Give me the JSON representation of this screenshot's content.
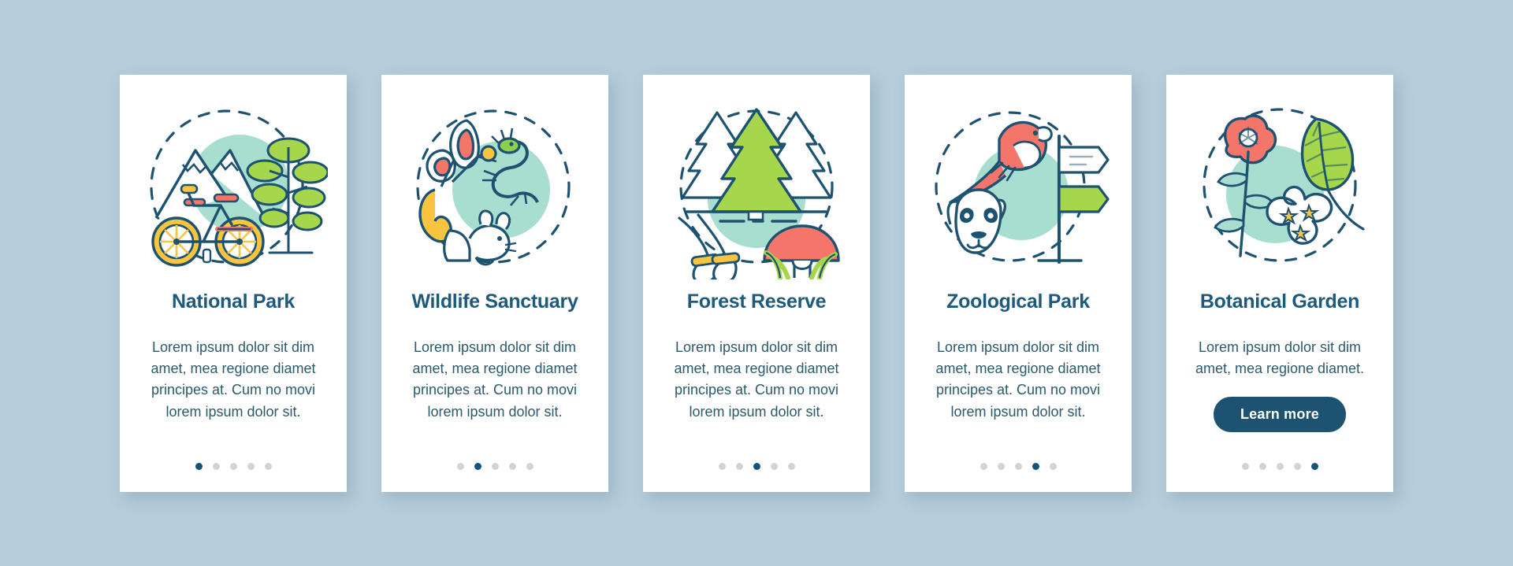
{
  "background_color": "#b5cdda",
  "theme": {
    "title_color": "#1e5a7d",
    "body_color": "#2b5b6b",
    "accent_dark": "#1d5271",
    "dot_active": "#14547c",
    "dot_inactive": "#cfd4d7",
    "illustration_green": "#a5d64c",
    "illustration_mint": "#a8ded0",
    "illustration_coral": "#f4766a",
    "illustration_yellow": "#f9c440",
    "illustration_outline": "#1d5271"
  },
  "cards": [
    {
      "id": "national-park",
      "title": "National Park",
      "body": "Lorem ipsum dolor sit dim amet, mea regione diamet principes at. Cum no movi lorem ipsum dolor sit.",
      "illustration": "mountains-bicycle-tree-icon",
      "has_button": false,
      "button_label": "",
      "dots": {
        "count": 5,
        "active": 0
      }
    },
    {
      "id": "wildlife-sanctuary",
      "title": "Wildlife Sanctuary",
      "body": "Lorem ipsum dolor sit dim amet, mea regione diamet principes at. Cum no movi lorem ipsum dolor sit.",
      "illustration": "butterfly-squirrel-lizard-icon",
      "has_button": false,
      "button_label": "",
      "dots": {
        "count": 5,
        "active": 1
      }
    },
    {
      "id": "forest-reserve",
      "title": "Forest Reserve",
      "body": "Lorem ipsum dolor sit dim amet, mea regione diamet principes at. Cum no movi lorem ipsum dolor sit.",
      "illustration": "pine-trees-mushroom-acorn-icon",
      "has_button": false,
      "button_label": "",
      "dots": {
        "count": 5,
        "active": 2
      }
    },
    {
      "id": "zoological-park",
      "title": "Zoological Park",
      "body": "Lorem ipsum dolor sit dim amet, mea regione diamet principes at. Cum no movi lorem ipsum dolor sit.",
      "illustration": "parrot-raccoon-signpost-icon",
      "has_button": false,
      "button_label": "",
      "dots": {
        "count": 5,
        "active": 3
      }
    },
    {
      "id": "botanical-garden",
      "title": "Botanical Garden",
      "body": "Lorem ipsum dolor sit dim amet, mea regione diamet.",
      "illustration": "poppy-leaf-flower-icon",
      "has_button": true,
      "button_label": "Learn more",
      "dots": {
        "count": 5,
        "active": 4
      }
    }
  ]
}
